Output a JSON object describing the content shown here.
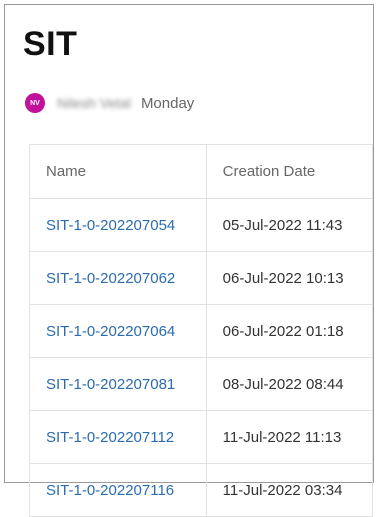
{
  "page": {
    "title": "SIT"
  },
  "meta": {
    "avatar_initials": "NV",
    "avatar_color": "#c2129b",
    "author": "Nilesh Vetal",
    "modified": "Monday"
  },
  "table": {
    "headers": {
      "name": "Name",
      "creation_date": "Creation Date"
    },
    "rows": [
      {
        "name": "SIT-1-0-202207054",
        "date": "05-Jul-2022 11:43"
      },
      {
        "name": "SIT-1-0-202207062",
        "date": "06-Jul-2022 10:13"
      },
      {
        "name": "SIT-1-0-202207064",
        "date": "06-Jul-2022 01:18"
      },
      {
        "name": "SIT-1-0-202207081",
        "date": "08-Jul-2022 08:44"
      },
      {
        "name": "SIT-1-0-202207112",
        "date": "11-Jul-2022 11:13"
      },
      {
        "name": "SIT-1-0-202207116",
        "date": "11-Jul-2022 03:34"
      }
    ]
  }
}
